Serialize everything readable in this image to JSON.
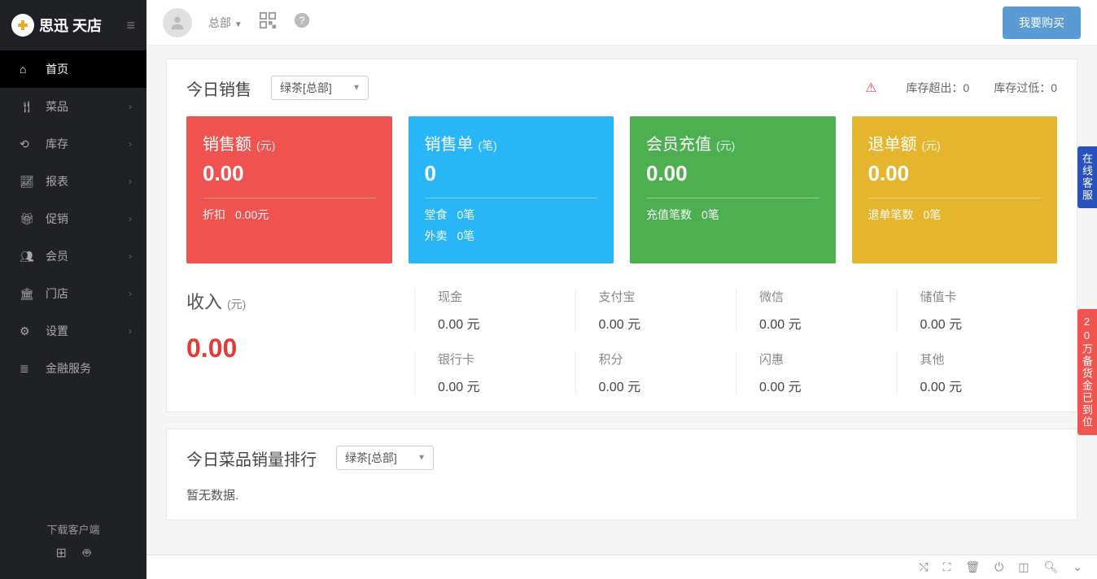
{
  "brand": "思迅 天店",
  "topbar": {
    "org": "总部",
    "buy_label": "我要购买"
  },
  "sidebar": {
    "items": [
      {
        "icon": "home-icon",
        "label": "首页",
        "active": true,
        "expandable": false
      },
      {
        "icon": "dishes-icon",
        "label": "菜品",
        "expandable": true
      },
      {
        "icon": "inventory-icon",
        "label": "库存",
        "expandable": true
      },
      {
        "icon": "reports-icon",
        "label": "报表",
        "expandable": true
      },
      {
        "icon": "promo-icon",
        "label": "促销",
        "expandable": true
      },
      {
        "icon": "members-icon",
        "label": "会员",
        "expandable": true
      },
      {
        "icon": "stores-icon",
        "label": "门店",
        "expandable": true
      },
      {
        "icon": "settings-icon",
        "label": "设置",
        "expandable": true
      },
      {
        "icon": "finance-icon",
        "label": "金融服务",
        "expandable": false
      }
    ],
    "download_label": "下载客户端"
  },
  "today_sales": {
    "title": "今日销售",
    "store_selected": "绿茶[总部]",
    "stock_over_label": "库存超出：",
    "stock_over_val": "0",
    "stock_low_label": "库存过低：",
    "stock_low_val": "0"
  },
  "cards": [
    {
      "title": "销售额",
      "unit": "(元)",
      "value": "0.00",
      "subs": [
        {
          "label": "折扣",
          "val": "0.00元"
        }
      ],
      "cls": "card-red"
    },
    {
      "title": "销售单",
      "unit": "(笔)",
      "value": "0",
      "subs": [
        {
          "label": "堂食",
          "val": "0笔"
        },
        {
          "label": "外卖",
          "val": "0笔"
        }
      ],
      "cls": "card-blue"
    },
    {
      "title": "会员充值",
      "unit": "(元)",
      "value": "0.00",
      "subs": [
        {
          "label": "充值笔数",
          "val": "0笔"
        }
      ],
      "cls": "card-green"
    },
    {
      "title": "退单额",
      "unit": "(元)",
      "value": "0.00",
      "subs": [
        {
          "label": "退单笔数",
          "val": "0笔"
        }
      ],
      "cls": "card-orange"
    }
  ],
  "income": {
    "label": "收入",
    "unit": "(元)",
    "value": "0.00",
    "cells": [
      {
        "label": "现金",
        "val": "0.00 元"
      },
      {
        "label": "支付宝",
        "val": "0.00 元"
      },
      {
        "label": "微信",
        "val": "0.00 元"
      },
      {
        "label": "储值卡",
        "val": "0.00 元"
      },
      {
        "label": "银行卡",
        "val": "0.00 元"
      },
      {
        "label": "积分",
        "val": "0.00 元"
      },
      {
        "label": "闪惠",
        "val": "0.00 元"
      },
      {
        "label": "其他",
        "val": "0.00 元"
      }
    ]
  },
  "ranking": {
    "title": "今日菜品销量排行",
    "store_selected": "绿茶[总部]",
    "empty": "暂无数据."
  },
  "float_tabs": {
    "service": "在线客服",
    "promo": "20万备货金已到位"
  }
}
